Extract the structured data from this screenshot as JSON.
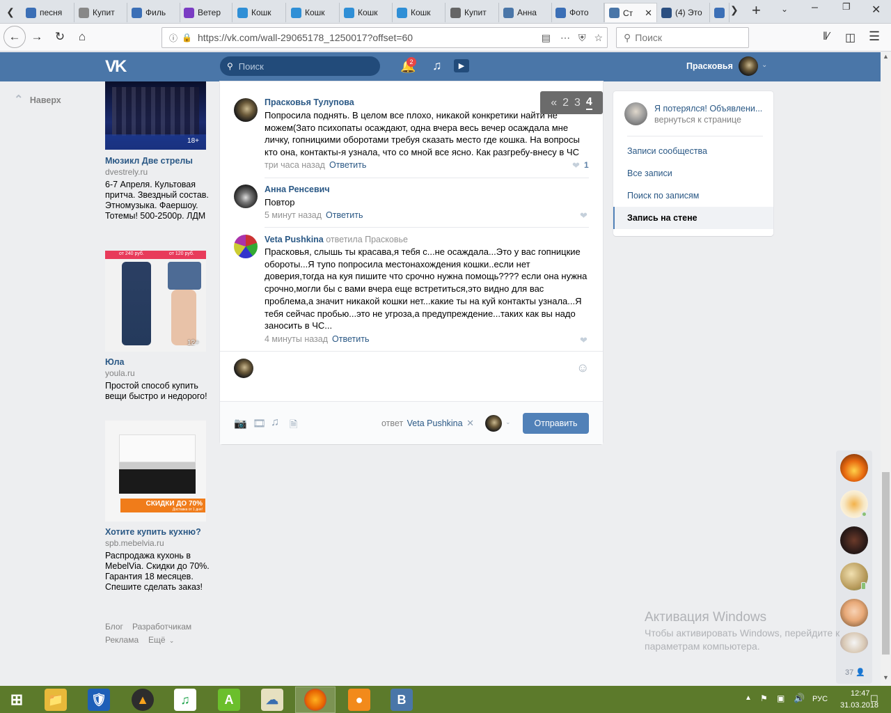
{
  "browser": {
    "tabs": [
      {
        "label": "песня",
        "icon": "pause-icon",
        "color": "#3b6fb6"
      },
      {
        "label": "Купит",
        "icon": "avito-icon",
        "color": "#888888"
      },
      {
        "label": "Филь",
        "icon": "film-icon",
        "color": "#3b6fb6"
      },
      {
        "label": "Ветер",
        "icon": "ivi-icon",
        "color": "#7a3cc3"
      },
      {
        "label": "Кошк",
        "icon": "cat-site-icon",
        "color": "#2f8fd6"
      },
      {
        "label": "Кошк",
        "icon": "cat-site-icon",
        "color": "#2f8fd6"
      },
      {
        "label": "Кошк",
        "icon": "cat-site-icon",
        "color": "#2f8fd6"
      },
      {
        "label": "Кошк",
        "icon": "cat-site-icon",
        "color": "#2f8fd6"
      },
      {
        "label": "Купит",
        "icon": "wine-icon",
        "color": "#666666"
      },
      {
        "label": "Анна",
        "icon": "vk-icon",
        "color": "#4a76a8"
      },
      {
        "label": "Фото",
        "icon": "photo-icon",
        "color": "#3b6fb6"
      },
      {
        "label": "Ст",
        "icon": "vk-icon",
        "color": "#4a76a8"
      },
      {
        "label": "(4) Это",
        "icon": "window-icon",
        "color": "#2b4f81"
      },
      {
        "label": "",
        "icon": "film-icon",
        "color": "#3b6fb6"
      }
    ],
    "url": "https://vk.com/wall-29065178_1250017?offset=60",
    "search_placeholder": "Поиск"
  },
  "vk_header": {
    "logo": "VK",
    "search_placeholder": "Поиск",
    "notifications_badge": "2",
    "user_name": "Прасковья"
  },
  "left": {
    "up_button": "Наверх",
    "ads": [
      {
        "title": "Мюзикл Две стрелы",
        "domain": "dvestrely.ru",
        "text": "6-7 Апреля. Культовая притча. Звездный состав. Этномузыка. Фаершоу. Тотемы! 500-2500р. ЛДМ",
        "age": "18+"
      },
      {
        "title": "Юла",
        "domain": "youla.ru",
        "text": "Простой способ купить вещи быстро и недорого!",
        "age": "12+",
        "price1": "от 240 руб.",
        "price2": "от 120 руб."
      },
      {
        "title": "Хотите купить кухню?",
        "domain": "spb.mebelvia.ru",
        "text": "Распродажа кухонь в MebelVia. Скидки до 70%. Гарантия 18 месяцев. Спешите сделать заказ!",
        "banner": "СКИДКИ ДО 70%",
        "banner_sub": "Доставка от 1 дня!"
      }
    ],
    "footer": {
      "blog": "Блог",
      "dev": "Разработчикам",
      "ads": "Реклама",
      "more": "Ещё"
    }
  },
  "comments": [
    {
      "author": "Прасковья Тулупова",
      "text": "Попросила поднять. В целом все плохо, никакой конкретики найти не можем(Зато психопаты осаждают, одна вчера весь вечер осаждала мне личку, гопницкими оборотами требуя сказать место где кошка. На вопросы кто она, контакты-я узнала, что со мной все ясно. Как разгребу-внесу в ЧС",
      "time": "три часа назад",
      "reply": "Ответить",
      "likes": "1"
    },
    {
      "author": "Анна Ренсевич",
      "text": "Повтор",
      "time": "5 минут назад",
      "reply": "Ответить",
      "likes": ""
    },
    {
      "author": "Veta Pushkina",
      "replied_to": "ответила Прасковье",
      "text": "Прасковья, слышь ты красава,я тебя с...не осаждала...Это у вас гопницкие обороты...Я тупо попросила местонахождения кошки..если нет доверия,тогда на куя пишите что срочно нужна помощь???? если она нужна срочно,могли бы с вами вчера еще встретиться,это видно для вас проблема,а значит никакой кошки нет...какие ты на куй контакты узнала...Я тебя сейчас пробью...это не угроза,а предупреждение...таких как вы надо заносить в ЧС...",
      "time": "4 минуты назад",
      "reply": "Ответить",
      "likes": ""
    }
  ],
  "pager": {
    "prev": "«",
    "pages": [
      "2",
      "3",
      "4"
    ],
    "current": "4"
  },
  "composer": {
    "reply_to_label": "ответ",
    "reply_to_name": "Veta Pushkina",
    "send": "Отправить"
  },
  "right_menu": {
    "lost_title": "Я потерялся! Объявлени...",
    "lost_sub": "вернуться к странице",
    "items": [
      "Записи сообщества",
      "Все записи",
      "Поиск по записям",
      "Запись на стене"
    ],
    "selected": "Запись на стене"
  },
  "friends": {
    "count": "37"
  },
  "watermark": {
    "title": "Активация Windows",
    "line1": "Чтобы активировать Windows, перейдите к",
    "line2": "параметрам компьютера."
  },
  "taskbar": {
    "lang": "РУС",
    "time": "12:47",
    "date": "31.03.2018"
  },
  "colors": {
    "vk_blue": "#4a76a8",
    "link": "#2a5885",
    "taskbar": "#5c7a2b"
  }
}
